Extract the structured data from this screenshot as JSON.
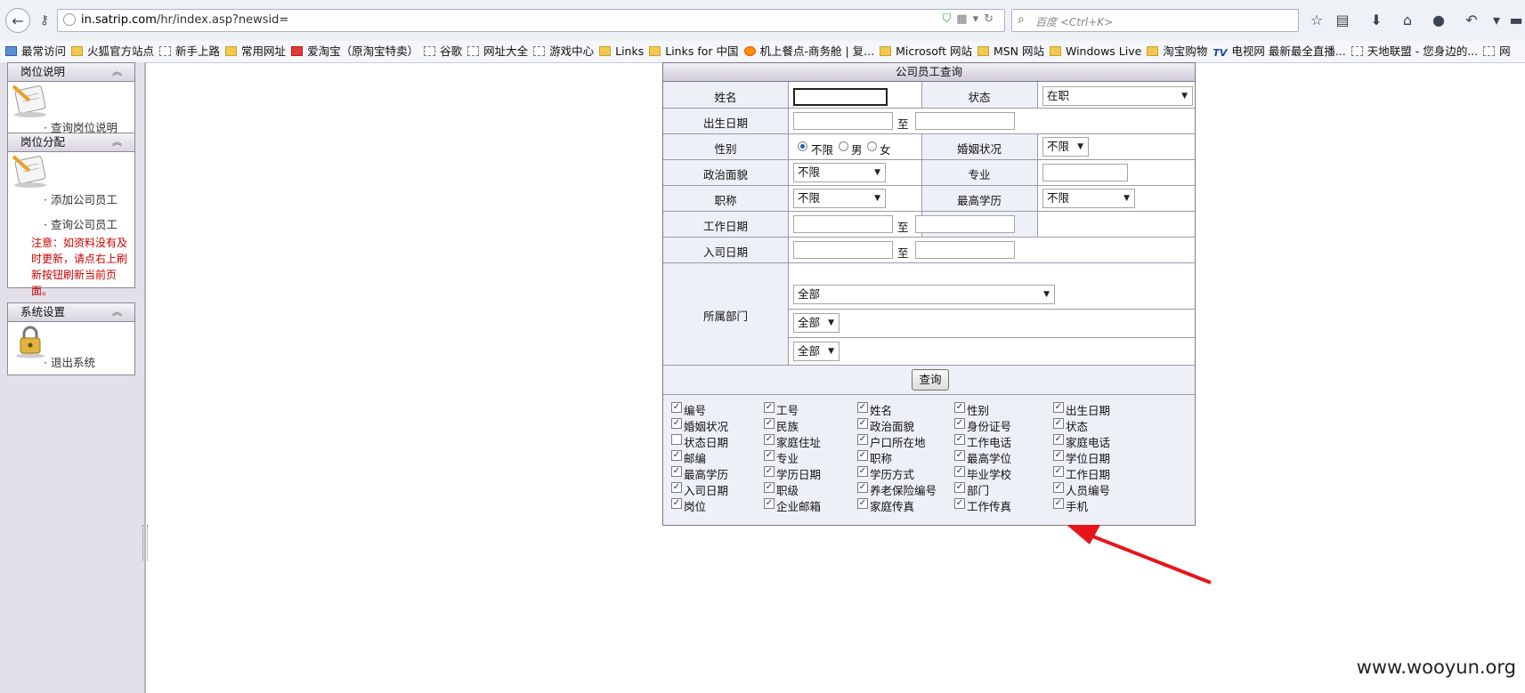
{
  "browser": {
    "url_host": "in.satrip.com",
    "url_path": "/hr/index.asp?newsid=",
    "search_placeholder": "百度 <Ctrl+K>"
  },
  "bookmarks": [
    {
      "label": "最常访问",
      "icon": "blue"
    },
    {
      "label": "火狐官方站点",
      "icon": "folder"
    },
    {
      "label": "新手上路",
      "icon": "page"
    },
    {
      "label": "常用网址",
      "icon": "folder"
    },
    {
      "label": "爱淘宝（原淘宝特卖）",
      "icon": "tb"
    },
    {
      "label": "谷歌",
      "icon": "page"
    },
    {
      "label": "网址大全",
      "icon": "page"
    },
    {
      "label": "游戏中心",
      "icon": "page"
    },
    {
      "label": "Links",
      "icon": "folder"
    },
    {
      "label": "Links for 中国",
      "icon": "folder"
    },
    {
      "label": "机上餐点-商务舱 | 复...",
      "icon": "fox"
    },
    {
      "label": "Microsoft 网站",
      "icon": "folder"
    },
    {
      "label": "MSN 网站",
      "icon": "folder"
    },
    {
      "label": "Windows Live",
      "icon": "folder"
    },
    {
      "label": "淘宝购物",
      "icon": "folder"
    },
    {
      "label": "电视网 最新最全直播...",
      "icon": "tv"
    },
    {
      "label": "天地联盟 - 您身边的...",
      "icon": "page"
    },
    {
      "label": "网",
      "icon": "page"
    }
  ],
  "sidebar": {
    "panel1": {
      "title": "岗位说明",
      "links": [
        "· 查询岗位说明"
      ]
    },
    "panel2": {
      "title": "岗位分配",
      "links": [
        "· 添加公司员工",
        "· 查询公司员工"
      ],
      "note": "注意：如资料没有及时更新，请点右上刷新按钮刷新当前页面。"
    },
    "panel3": {
      "title": "系统设置",
      "links": [
        "· 退出系统"
      ]
    }
  },
  "form": {
    "title": "公司员工查询",
    "name_label": "姓名",
    "status_label": "状态",
    "status_value": "在职",
    "birth_label": "出生日期",
    "to": "至",
    "gender_label": "性别",
    "gender_options": [
      "不限",
      "男",
      "女"
    ],
    "marital_label": "婚姻状况",
    "marital_value": "不限",
    "political_label": "政治面貌",
    "political_value": "不限",
    "major_label": "专业",
    "title_label": "职称",
    "title_value": "不限",
    "edu_label": "最高学历",
    "edu_value": "不限",
    "workdate_label": "工作日期",
    "joindate_label": "入司日期",
    "dept_label": "所属部门",
    "dept1": "全部",
    "dept2": "全部",
    "dept3": "全部",
    "query_button": "查询"
  },
  "fields": [
    {
      "label": "编号",
      "checked": true
    },
    {
      "label": "工号",
      "checked": true
    },
    {
      "label": "姓名",
      "checked": true
    },
    {
      "label": "性别",
      "checked": true
    },
    {
      "label": "出生日期",
      "checked": true
    },
    {
      "label": "婚姻状况",
      "checked": true
    },
    {
      "label": "民族",
      "checked": true
    },
    {
      "label": "政治面貌",
      "checked": true
    },
    {
      "label": "身份证号",
      "checked": true
    },
    {
      "label": "状态",
      "checked": true
    },
    {
      "label": "状态日期",
      "checked": false
    },
    {
      "label": "家庭住址",
      "checked": true
    },
    {
      "label": "户口所在地",
      "checked": true
    },
    {
      "label": "工作电话",
      "checked": true
    },
    {
      "label": "家庭电话",
      "checked": true
    },
    {
      "label": "邮编",
      "checked": true
    },
    {
      "label": "专业",
      "checked": true
    },
    {
      "label": "职称",
      "checked": true
    },
    {
      "label": "最高学位",
      "checked": true
    },
    {
      "label": "学位日期",
      "checked": true
    },
    {
      "label": "最高学历",
      "checked": true
    },
    {
      "label": "学历日期",
      "checked": true
    },
    {
      "label": "学历方式",
      "checked": true
    },
    {
      "label": "毕业学校",
      "checked": true
    },
    {
      "label": "工作日期",
      "checked": true
    },
    {
      "label": "入司日期",
      "checked": true
    },
    {
      "label": "职级",
      "checked": true
    },
    {
      "label": "养老保险编号",
      "checked": true
    },
    {
      "label": "部门",
      "checked": true
    },
    {
      "label": "人员编号",
      "checked": true
    },
    {
      "label": "岗位",
      "checked": true
    },
    {
      "label": "企业邮箱",
      "checked": true
    },
    {
      "label": "家庭传真",
      "checked": true
    },
    {
      "label": "工作传真",
      "checked": true
    },
    {
      "label": "手机",
      "checked": true
    }
  ],
  "watermark": "www.wooyun.org",
  "colors": {
    "annotation_arrow": "#e8141b",
    "note_text": "#cc0000"
  }
}
